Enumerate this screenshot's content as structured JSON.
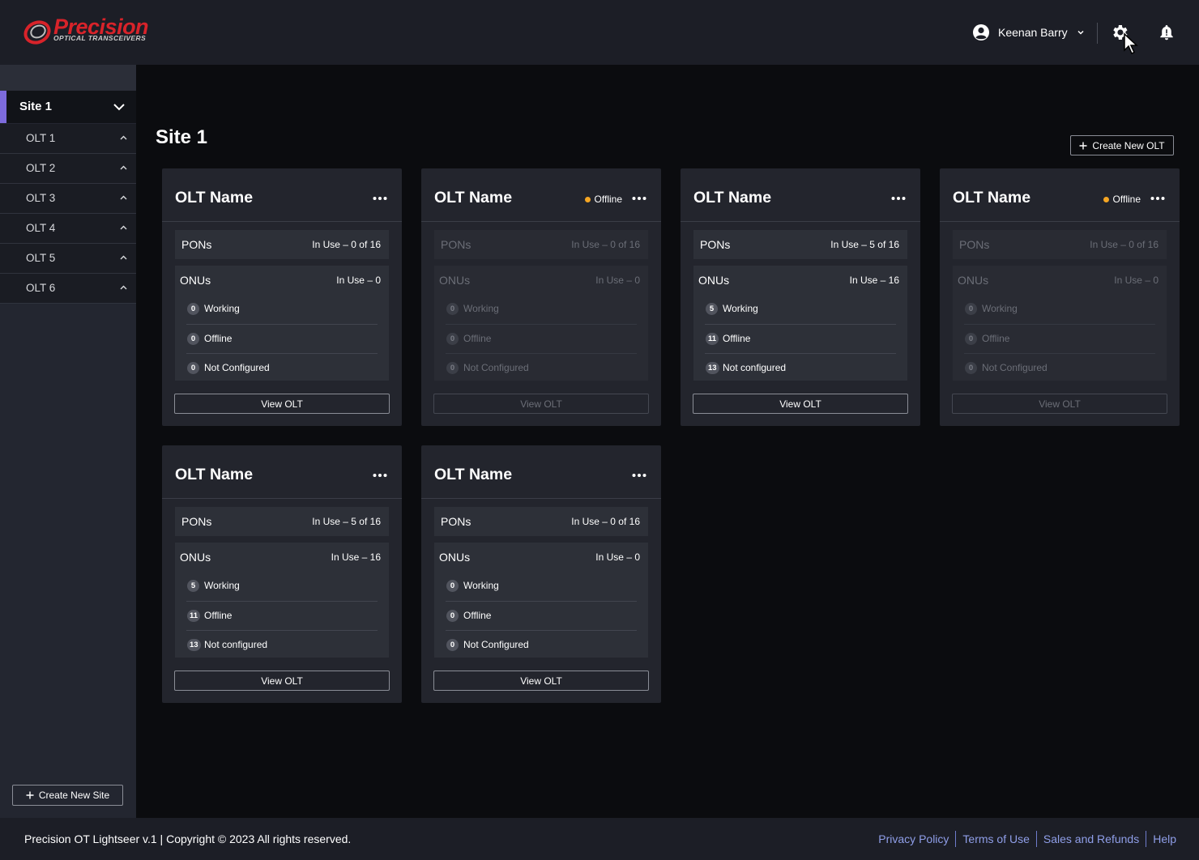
{
  "header": {
    "logo_word": "Precision",
    "logo_sub": "OPTICAL TRANSCEIVERS",
    "user_name": "Keenan Barry"
  },
  "sidebar": {
    "site": {
      "label": "Site 1"
    },
    "olts": [
      {
        "label": "OLT 1"
      },
      {
        "label": "OLT 2"
      },
      {
        "label": "OLT 3"
      },
      {
        "label": "OLT 4"
      },
      {
        "label": "OLT 5"
      },
      {
        "label": "OLT 6"
      }
    ],
    "create_site_label": "Create New Site"
  },
  "main": {
    "title": "Site 1",
    "create_olt_label": "Create New OLT",
    "cards": [
      {
        "name": "OLT Name",
        "status": "",
        "dimmed": false,
        "pons_label": "PONs",
        "pons_value": "In Use – 0 of 16",
        "onus_label": "ONUs",
        "onus_value": "In Use – 0",
        "rows": [
          {
            "count": "0",
            "label": "Working"
          },
          {
            "count": "0",
            "label": "Offline"
          },
          {
            "count": "0",
            "label": "Not Configured"
          }
        ],
        "button": "View OLT"
      },
      {
        "name": "OLT Name",
        "status": "Offline",
        "dimmed": true,
        "pons_label": "PONs",
        "pons_value": "In Use – 0 of 16",
        "onus_label": "ONUs",
        "onus_value": "In Use – 0",
        "rows": [
          {
            "count": "0",
            "label": "Working"
          },
          {
            "count": "0",
            "label": "Offline"
          },
          {
            "count": "0",
            "label": "Not Configured"
          }
        ],
        "button": "View OLT"
      },
      {
        "name": "OLT Name",
        "status": "",
        "dimmed": false,
        "pons_label": "PONs",
        "pons_value": "In Use – 5 of 16",
        "onus_label": "ONUs",
        "onus_value": "In Use – 16",
        "rows": [
          {
            "count": "5",
            "label": "Working"
          },
          {
            "count": "11",
            "label": "Offline"
          },
          {
            "count": "13",
            "label": "Not configured"
          }
        ],
        "button": "View OLT"
      },
      {
        "name": "OLT Name",
        "status": "Offline",
        "dimmed": true,
        "pons_label": "PONs",
        "pons_value": "In Use – 0 of 16",
        "onus_label": "ONUs",
        "onus_value": "In Use – 0",
        "rows": [
          {
            "count": "0",
            "label": "Working"
          },
          {
            "count": "0",
            "label": "Offline"
          },
          {
            "count": "0",
            "label": "Not Configured"
          }
        ],
        "button": "View OLT"
      },
      {
        "name": "OLT Name",
        "status": "",
        "dimmed": false,
        "pons_label": "PONs",
        "pons_value": "In Use – 5 of 16",
        "onus_label": "ONUs",
        "onus_value": "In Use – 16",
        "rows": [
          {
            "count": "5",
            "label": "Working"
          },
          {
            "count": "11",
            "label": "Offline"
          },
          {
            "count": "13",
            "label": "Not configured"
          }
        ],
        "button": "View OLT"
      },
      {
        "name": "OLT Name",
        "status": "",
        "dimmed": false,
        "pons_label": "PONs",
        "pons_value": "In Use – 0 of 16",
        "onus_label": "ONUs",
        "onus_value": "In Use – 0",
        "rows": [
          {
            "count": "0",
            "label": "Working"
          },
          {
            "count": "0",
            "label": "Offline"
          },
          {
            "count": "0",
            "label": "Not Configured"
          }
        ],
        "button": "View OLT"
      }
    ]
  },
  "footer": {
    "copyright": "Precision OT Lightseer v.1 |  Copyright © 2023  All rights reserved.",
    "links": [
      "Privacy Policy",
      "Terms of Use",
      "Sales and Refunds",
      "Help"
    ]
  },
  "colors": {
    "accent": "#7d6bdc",
    "brand_red": "#d8232a",
    "status_offline": "#f5a623",
    "link": "#8f9ee8"
  }
}
